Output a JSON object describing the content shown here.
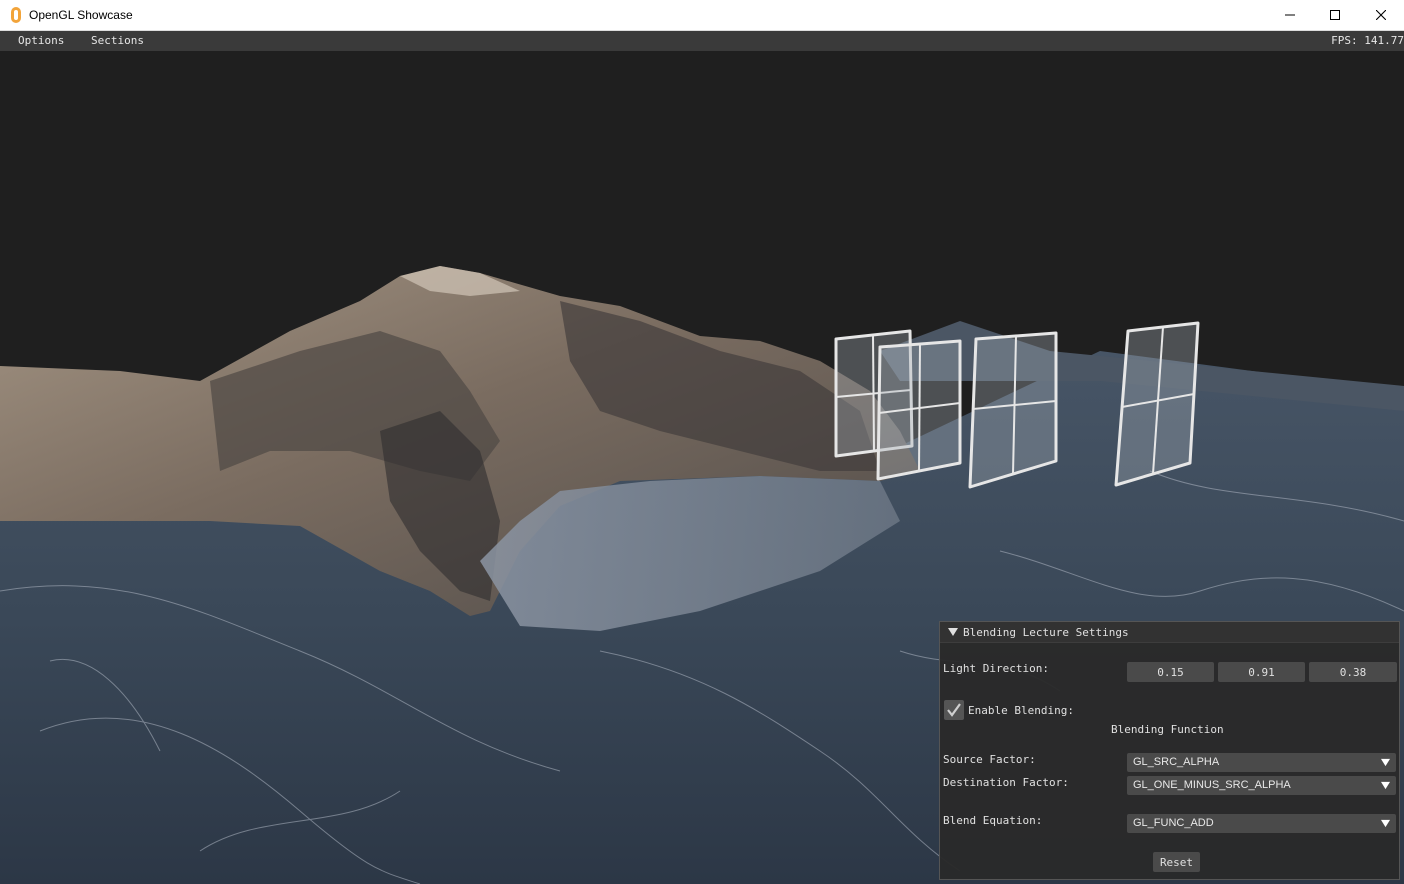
{
  "window": {
    "title": "OpenGL Showcase",
    "icon": "opengl-app-icon",
    "controls": [
      "minimize-icon",
      "maximize-icon",
      "close-icon"
    ]
  },
  "menubar": {
    "items": [
      "Options",
      "Sections"
    ],
    "fps": "FPS: 141.77"
  },
  "panel": {
    "title": "Blending Lecture Settings",
    "light_direction": {
      "label": "Light Direction:",
      "values": [
        "0.15",
        "0.91",
        "0.38"
      ]
    },
    "enable_blending": {
      "label": "Enable Blending:",
      "checked": true
    },
    "section_heading": "Blending Function",
    "source_factor": {
      "label": "Source Factor:",
      "value": "GL_SRC_ALPHA"
    },
    "destination_factor": {
      "label": "Destination Factor:",
      "value": "GL_ONE_MINUS_SRC_ALPHA"
    },
    "blend_equation": {
      "label": "Blend Equation:",
      "value": "GL_FUNC_ADD"
    },
    "reset_label": "Reset"
  },
  "colors": {
    "sky": "#1f1f1f",
    "menubar": "#3a3a3a",
    "panel_bg": "#2a2a2a",
    "widget_bg": "#4a4a4a",
    "water": "#3b4a5c",
    "mountain": "#8a7d70"
  }
}
